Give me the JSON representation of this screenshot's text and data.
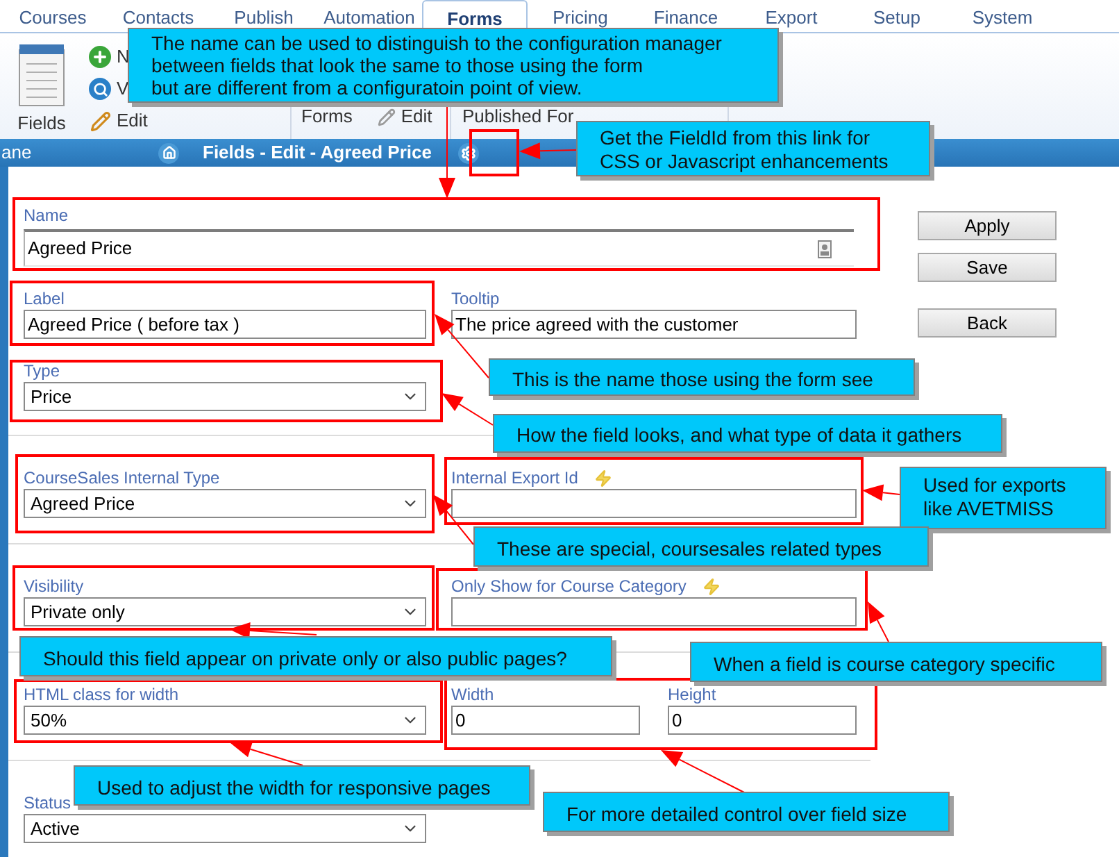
{
  "tabs": [
    {
      "label": "Courses",
      "selected": false
    },
    {
      "label": "Contacts",
      "selected": false
    },
    {
      "label": "Publish",
      "selected": false
    },
    {
      "label": "Automation",
      "selected": false
    },
    {
      "label": "Forms",
      "selected": true
    },
    {
      "label": "Pricing",
      "selected": false
    },
    {
      "label": "Finance",
      "selected": false
    },
    {
      "label": "Export",
      "selected": false
    },
    {
      "label": "Setup",
      "selected": false
    },
    {
      "label": "System",
      "selected": false
    }
  ],
  "ribbon": {
    "big_button": "Fields",
    "items": [
      {
        "kind": "add",
        "label": "N"
      },
      {
        "kind": "view",
        "label": "V"
      },
      {
        "kind": "edit",
        "label": "Edit"
      }
    ],
    "groups": [
      {
        "label": "Forms",
        "items": [
          {
            "kind": "edit_grey",
            "label": "Edit"
          }
        ]
      },
      {
        "label": "Published For"
      }
    ]
  },
  "title_bar": {
    "pane_label": "ane",
    "title": "Fields - Edit - Agreed Price"
  },
  "form": {
    "sections": [
      [
        {
          "fields": [
            {
              "kind": "wide",
              "label": "Name",
              "value": "Agreed Price",
              "field_icon": true
            }
          ]
        },
        {
          "fields": [
            {
              "kind": "text",
              "label": "Label",
              "value": "Agreed Price ( before tax )"
            },
            {
              "kind": "text",
              "label": "Tooltip",
              "value": "The price agreed with the customer"
            }
          ]
        },
        {
          "fields": [
            {
              "kind": "select",
              "label": "Type",
              "value": "Price"
            }
          ]
        }
      ],
      [
        {
          "fields": [
            {
              "kind": "select",
              "label": "CourseSales Internal Type",
              "value": "Agreed Price"
            },
            {
              "kind": "text",
              "label": "Internal Export Id",
              "special": true
            }
          ]
        }
      ],
      [
        {
          "fields": [
            {
              "kind": "select",
              "label": "Visibility",
              "value": "Private only"
            },
            {
              "kind": "text",
              "label": "Only Show for Course Category",
              "special": true
            }
          ]
        }
      ],
      [
        {
          "fields": [
            {
              "kind": "select",
              "label": "HTML class for width",
              "value": "50%"
            },
            {
              "kind": "text",
              "label": "Width",
              "value": "0"
            },
            {
              "kind": "text",
              "label": "Height",
              "value": "0"
            }
          ]
        }
      ],
      [
        {
          "fields": [
            {
              "kind": "select",
              "label": "Status",
              "value": "Active"
            }
          ]
        }
      ]
    ]
  },
  "buttons": [
    "Apply",
    "Save",
    "Back"
  ],
  "callouts": [
    {
      "lines": [
        "The name can be used to distinguish to the configuration manager",
        "between fields that look the same to those using the form",
        "but are different from a configuratoin point of view."
      ]
    },
    {
      "lines": [
        "Get the FieldId from this link for",
        "CSS or Javascript enhancements"
      ]
    },
    {
      "lines": [
        "This is the name those using the form see"
      ]
    },
    {
      "lines": [
        "How the field looks, and what type of data it gathers"
      ]
    },
    {
      "lines": [
        "Used for exports",
        "like AVETMISS"
      ]
    },
    {
      "lines": [
        "These are special, coursesales related types"
      ]
    },
    {
      "lines": [
        "Should this field appear on private only or also public pages?"
      ]
    },
    {
      "lines": [
        "When a field is course category specific"
      ]
    },
    {
      "lines": [
        "Used to adjust the width for responsive pages"
      ]
    },
    {
      "lines": [
        "For more detailed control over field size"
      ]
    }
  ]
}
